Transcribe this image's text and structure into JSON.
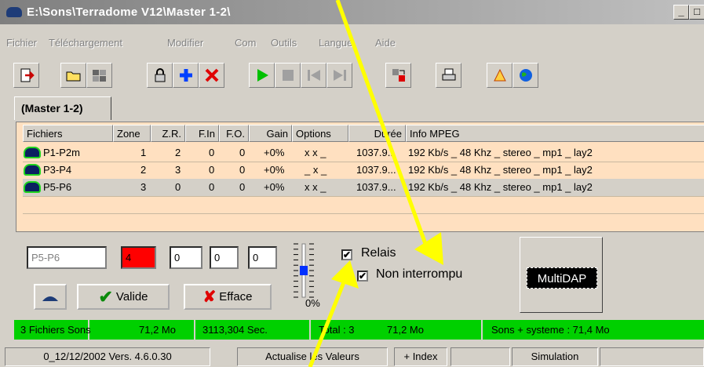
{
  "window": {
    "title": "E:\\Sons\\Terradome V12\\Master 1-2\\",
    "min_btn": "_",
    "max_btn": "□"
  },
  "menu": [
    "Fichier",
    "Téléchargement",
    "Modifier",
    "Com",
    "Outils",
    "Langue",
    "Aide"
  ],
  "toolbar": {
    "icons": [
      "exit-icon",
      "open-folder-icon",
      "folders-icon",
      "lock-icon",
      "add-icon",
      "delete-icon",
      "play-icon",
      "stop-icon",
      "prev-icon",
      "next-icon",
      "transfer-icon",
      "print-icon",
      "help-icon",
      "globe-icon"
    ]
  },
  "tab": {
    "label": "(Master 1-2)"
  },
  "table": {
    "columns": [
      "Fichiers",
      "Zone",
      "Z.R.",
      "F.In",
      "F.O.",
      "Gain",
      "Options",
      "Durée",
      "Info MPEG"
    ],
    "rows": [
      {
        "name": "P1-P2m",
        "zone": "1",
        "zr": "2",
        "fin": "0",
        "fo": "0",
        "gain": "+0%",
        "options": "x x _",
        "duree": "1037.9...",
        "info": "192 Kb/s _ 48 Khz _ stereo _ mp1 _ lay2"
      },
      {
        "name": "P3-P4",
        "zone": "2",
        "zr": "3",
        "fin": "0",
        "fo": "0",
        "gain": "+0%",
        "options": "_ x _",
        "duree": "1037.9...",
        "info": "192 Kb/s _ 48 Khz _ stereo _ mp1 _ lay2"
      },
      {
        "name": "P5-P6",
        "zone": "3",
        "zr": "0",
        "fin": "0",
        "fo": "0",
        "gain": "+0%",
        "options": "x x _",
        "duree": "1037.9...",
        "info": "192 Kb/s _ 48 Khz _ stereo _ mp1 _ lay2"
      }
    ]
  },
  "editor": {
    "name_value": "P5-P6",
    "zone_value": "4",
    "field2": "0",
    "field3": "0",
    "field4": "0",
    "slider_label": "0%",
    "slider_level": 0.5,
    "valide_label": "Valide",
    "efface_label": "Efface",
    "relais_label": "Relais",
    "relais_checked": "✔",
    "non_interrompu_label": "Non interrompu",
    "non_interrompu_checked": "✔",
    "multidap_label": "MultiDAP"
  },
  "summary": {
    "files": "3 Fichiers Sons",
    "size": "71,2 Mo",
    "secs": "3113,304 Sec.",
    "total": "Total : 3",
    "total_size": "71,2 Mo",
    "system": "Sons + systeme : 71,4 Mo"
  },
  "statusbar": {
    "version": "0_12/12/2002 Vers. 4.6.0.30",
    "refresh": "Actualise les Valeurs",
    "index": "+ Index",
    "simulation": "Simulation"
  },
  "colors": {
    "grid_bg": "#ffe0c0",
    "green_bar": "#00d000",
    "arrow": "#ffff00",
    "zone_field": "#ff0000"
  }
}
